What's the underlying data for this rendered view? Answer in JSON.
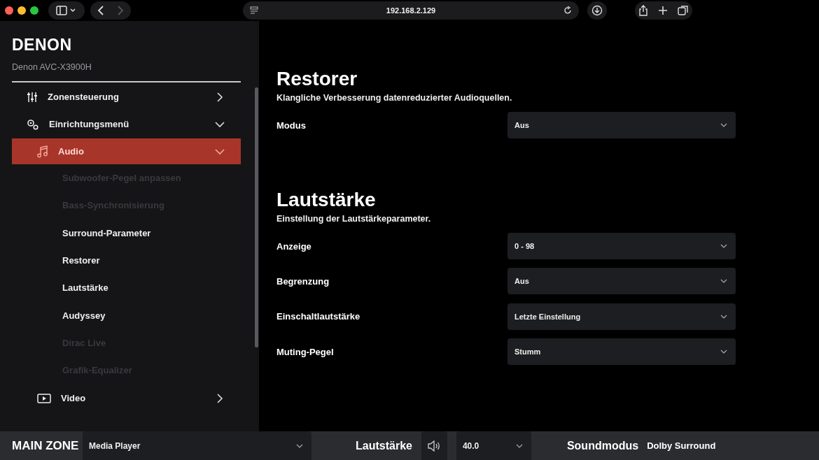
{
  "browser": {
    "address": "192.168.2.129"
  },
  "sidebar": {
    "brand": "DENON",
    "model": "Denon AVC-X3900H",
    "items": [
      {
        "label": "Zonensteuerung",
        "expanded": false,
        "selected": false
      },
      {
        "label": "Einrichtungsmenü",
        "expanded": true,
        "selected": false,
        "children": [
          {
            "label": "Audio",
            "expanded": true,
            "selected": true,
            "children": [
              {
                "label": "Subwoofer-Pegel anpassen",
                "disabled": true
              },
              {
                "label": "Bass-Synchronisierung",
                "disabled": true
              },
              {
                "label": "Surround-Parameter",
                "disabled": false
              },
              {
                "label": "Restorer",
                "disabled": false
              },
              {
                "label": "Lautstärke",
                "disabled": false
              },
              {
                "label": "Audyssey",
                "disabled": false
              },
              {
                "label": "Dirac Live",
                "disabled": true
              },
              {
                "label": "Grafik-Equalizer",
                "disabled": true
              }
            ]
          },
          {
            "label": "Video",
            "expanded": false,
            "selected": false
          }
        ]
      }
    ]
  },
  "sections": [
    {
      "title": "Restorer",
      "description": "Klangliche Verbesserung datenreduzierter Audioquellen.",
      "settings": [
        {
          "label": "Modus",
          "value": "Aus"
        }
      ]
    },
    {
      "title": "Lautstärke",
      "description": "Einstellung der Lautstärkeparameter.",
      "settings": [
        {
          "label": "Anzeige",
          "value": "0 - 98"
        },
        {
          "label": "Begrenzung",
          "value": "Aus"
        },
        {
          "label": "Einschaltlautstärke",
          "value": "Letzte Einstellung"
        },
        {
          "label": "Muting-Pegel",
          "value": "Stumm"
        }
      ]
    }
  ],
  "bottom_bar": {
    "zone": "MAIN ZONE",
    "source": "Media Player",
    "volume_label": "Lautstärke",
    "volume": "40.0",
    "sound_mode_label": "Soundmodus",
    "sound_mode": "Dolby Surround"
  }
}
